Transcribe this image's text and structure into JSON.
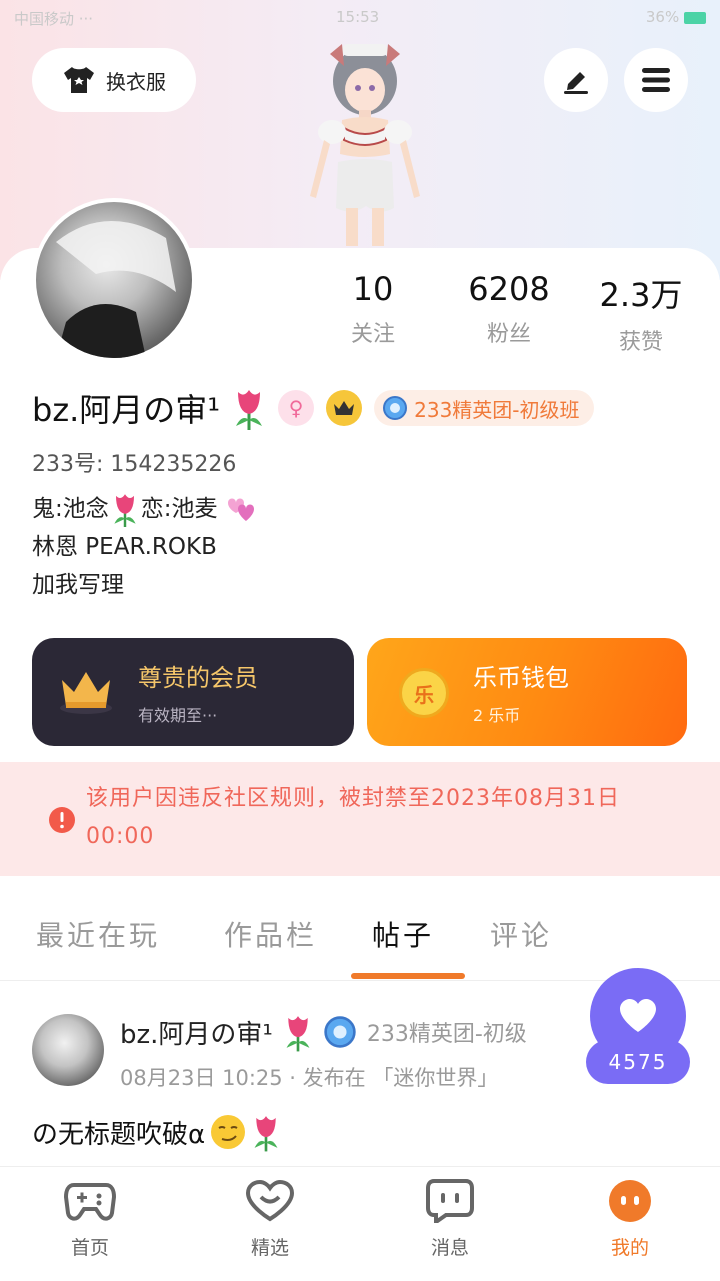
{
  "status_bar": {
    "left": "中国移动 ··· ",
    "time": "15:53",
    "battery": "36%"
  },
  "top": {
    "outfit_label": "换衣服"
  },
  "profile": {
    "stats": [
      {
        "value": "10",
        "label": "关注"
      },
      {
        "value": "6208",
        "label": "粉丝"
      },
      {
        "value": "2.3万",
        "label": "获赞"
      }
    ],
    "name": "bz.阿月の审¹",
    "team_badge": "233精英团-初级班",
    "uid": "233号: 154235226",
    "bio": {
      "line1_a": "鬼:池念",
      "line1_b": "恋:池麦",
      "line2": "林恩 PEAR.ROKB",
      "line3": "加我写理"
    }
  },
  "cards": {
    "vip": {
      "title": "尊贵的会员",
      "subtitle": "有效期至···"
    },
    "wallet": {
      "title": "乐币钱包",
      "subtitle": "2 乐币",
      "coin_char": "乐"
    }
  },
  "ban_notice": "该用户因违反社区规则，被封禁至2023年08月31日 00:00",
  "tabs": [
    {
      "label": "最近在玩"
    },
    {
      "label": "作品栏"
    },
    {
      "label": "帖子"
    },
    {
      "label": "评论"
    }
  ],
  "post": {
    "author": "bz.阿月の审¹",
    "team": "233精英团-初级",
    "meta": "08月23日 10:25 · 发布在 「迷你世界」",
    "body": "の无标题吹破α"
  },
  "like": {
    "count": "4575"
  },
  "nav": [
    {
      "label": "首页"
    },
    {
      "label": "精选"
    },
    {
      "label": "消息"
    },
    {
      "label": "我的"
    }
  ]
}
